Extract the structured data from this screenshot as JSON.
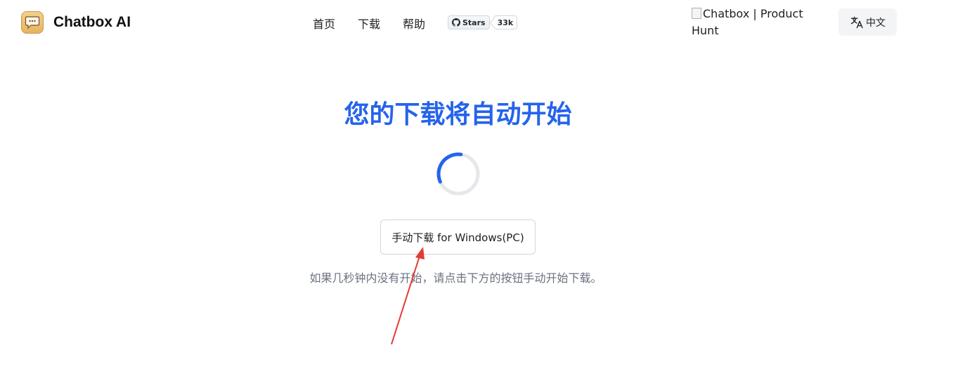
{
  "header": {
    "brand": "Chatbox AI",
    "nav": [
      {
        "label": "首页"
      },
      {
        "label": "下载"
      },
      {
        "label": "帮助"
      }
    ],
    "github": {
      "stars_label": "Stars",
      "count": "33k"
    },
    "product_hunt_alt": "Chatbox | Product Hunt",
    "language": {
      "label": "中文",
      "icon": "translate-icon"
    }
  },
  "main": {
    "title": "您的下载将自动开始",
    "spinner": {
      "icon": "loading-spinner-icon"
    },
    "manual_download_label": "手动下载 for Windows(PC)",
    "hint": "如果几秒钟内没有开始，请点击下方的按钮手动开始下载。"
  },
  "colors": {
    "accent": "#2563eb",
    "annotation_arrow": "#e53935",
    "hint_text": "#6b7280"
  }
}
